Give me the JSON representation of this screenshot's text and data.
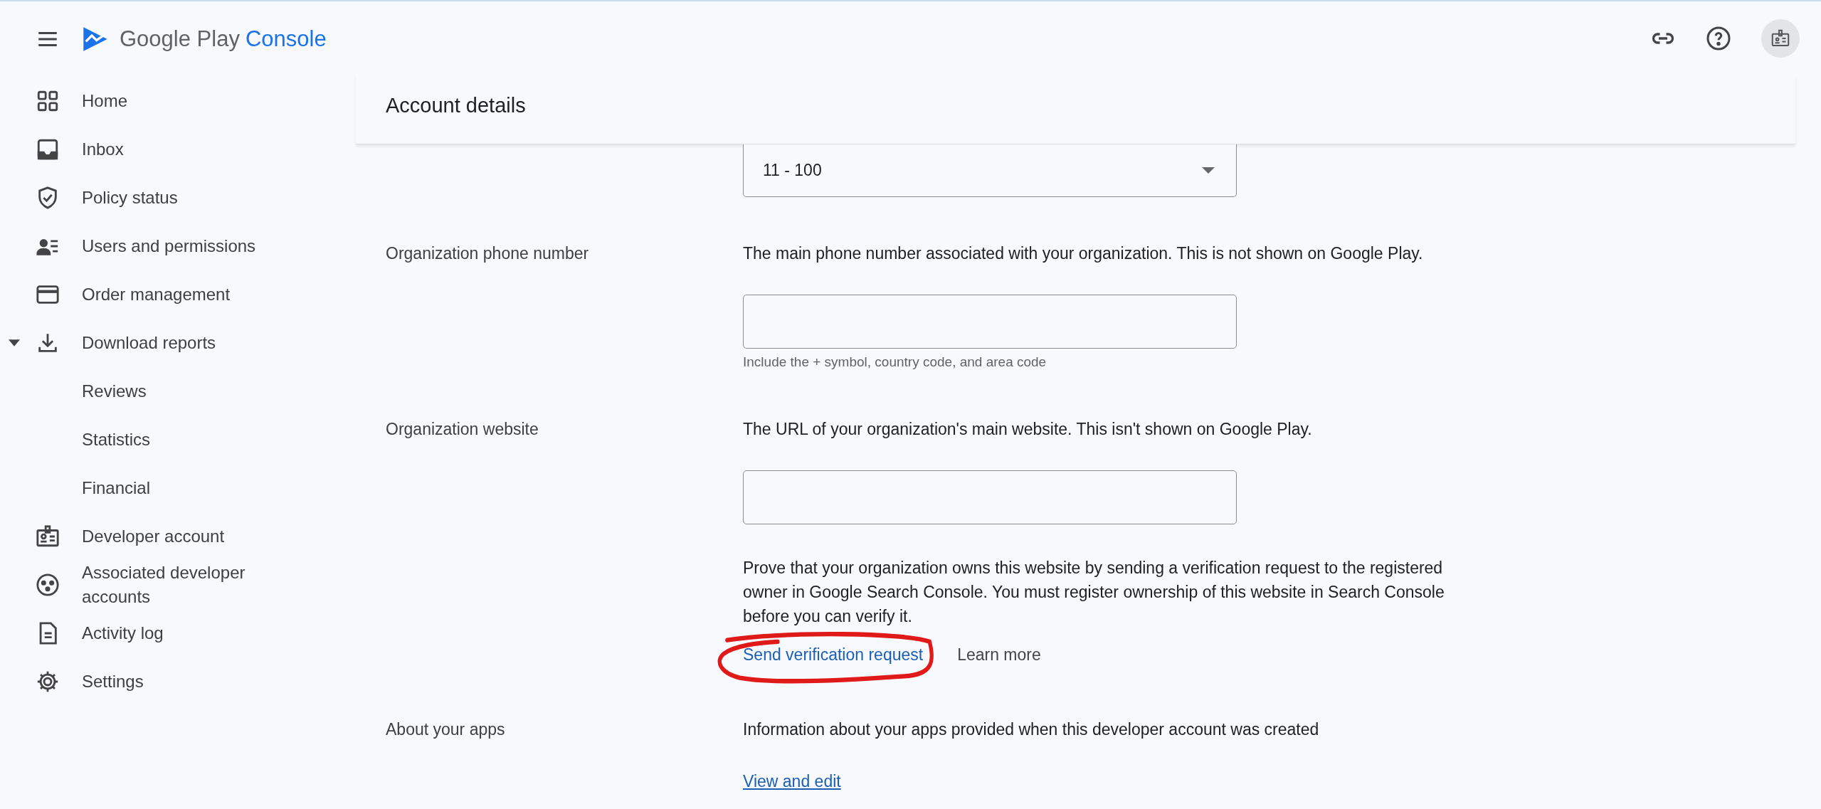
{
  "app_bar": {
    "brand": "Google Play",
    "brand_product": "Console"
  },
  "sidebar": {
    "items": [
      {
        "label": "Home"
      },
      {
        "label": "Inbox"
      },
      {
        "label": "Policy status"
      },
      {
        "label": "Users and permissions"
      },
      {
        "label": "Order management"
      },
      {
        "label": "Download reports",
        "expanded": true,
        "children": [
          {
            "label": "Reviews"
          },
          {
            "label": "Statistics"
          },
          {
            "label": "Financial"
          }
        ]
      },
      {
        "label": "Developer account"
      },
      {
        "label": "Associated developer accounts"
      },
      {
        "label": "Activity log"
      },
      {
        "label": "Settings"
      }
    ]
  },
  "page": {
    "title": "Account details",
    "organization_size": {
      "value": "11 - 100"
    },
    "rows": [
      {
        "label": "Organization phone number",
        "description": "The main phone number associated with your organization. This is not shown on Google Play.",
        "hint": "Include the + symbol, country code, and area code"
      },
      {
        "label": "Organization website",
        "description": "The URL of your organization's main website. This isn't shown on Google Play.",
        "note": "Prove that your organization owns this website by sending a verification request to the registered owner in Google Search Console. You must register ownership of this website in Search Console before you can verify it.",
        "action": "Send verification request",
        "secondary_action": "Learn more"
      }
    ],
    "about": {
      "label": "About your apps",
      "description": "Information about your apps provided when this developer account was created",
      "link": "View and edit"
    }
  }
}
